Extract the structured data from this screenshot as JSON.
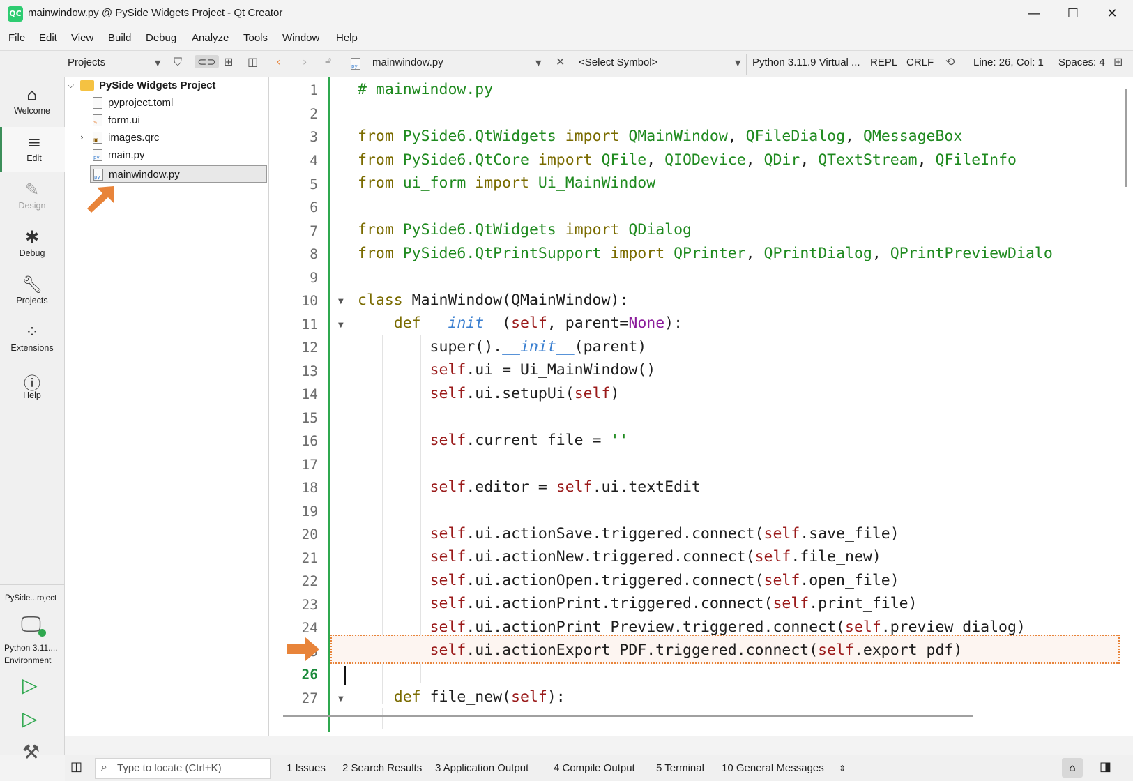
{
  "window": {
    "title": "mainwindow.py @ PySide Widgets Project - Qt Creator",
    "app_icon_text": "QC",
    "minimize": "—",
    "maximize": "☐",
    "close": "✕"
  },
  "menu": [
    "File",
    "Edit",
    "View",
    "Build",
    "Debug",
    "Analyze",
    "Tools",
    "Window",
    "Help"
  ],
  "toolbar": {
    "projects_label": "Projects",
    "file_name": "mainwindow.py",
    "symbol_placeholder": "<Select Symbol>",
    "interpreter": "Python 3.11.9 Virtual ...",
    "repl": "REPL",
    "line_ending": "CRLF",
    "position": "Line: 26, Col: 1",
    "spaces": "Spaces: 4"
  },
  "modes": [
    {
      "label": "Welcome",
      "icon": "home-icon"
    },
    {
      "label": "Edit",
      "icon": "edit-icon"
    },
    {
      "label": "Design",
      "icon": "design-icon"
    },
    {
      "label": "Debug",
      "icon": "debug-icon"
    },
    {
      "label": "Projects",
      "icon": "wrench-icon"
    },
    {
      "label": "Extensions",
      "icon": "extensions-icon"
    },
    {
      "label": "Help",
      "icon": "help-icon"
    }
  ],
  "kit": {
    "project_short": "PySide...roject",
    "env_line1": "Python 3.11....",
    "env_line2": "Environment"
  },
  "tree": {
    "project": "PySide Widgets Project",
    "files": [
      "pyproject.toml",
      "form.ui",
      "images.qrc",
      "main.py",
      "mainwindow.py"
    ]
  },
  "editor": {
    "current_line": 26,
    "line_numbers": [
      "1",
      "2",
      "3",
      "4",
      "5",
      "6",
      "7",
      "8",
      "9",
      "10",
      "11",
      "12",
      "13",
      "14",
      "15",
      "16",
      "17",
      "18",
      "19",
      "20",
      "21",
      "22",
      "23",
      "24",
      "5",
      "26",
      "27"
    ]
  },
  "statusbar": {
    "locate_placeholder": "Type to locate (Ctrl+K)",
    "tabs": [
      "1  Issues",
      "2  Search Results",
      "3  Application Output",
      "4  Compile Output",
      "5  Terminal",
      "10  General Messages"
    ]
  },
  "colors": {
    "accent_green": "#2fa84f",
    "highlight_orange": "#e8843a"
  }
}
